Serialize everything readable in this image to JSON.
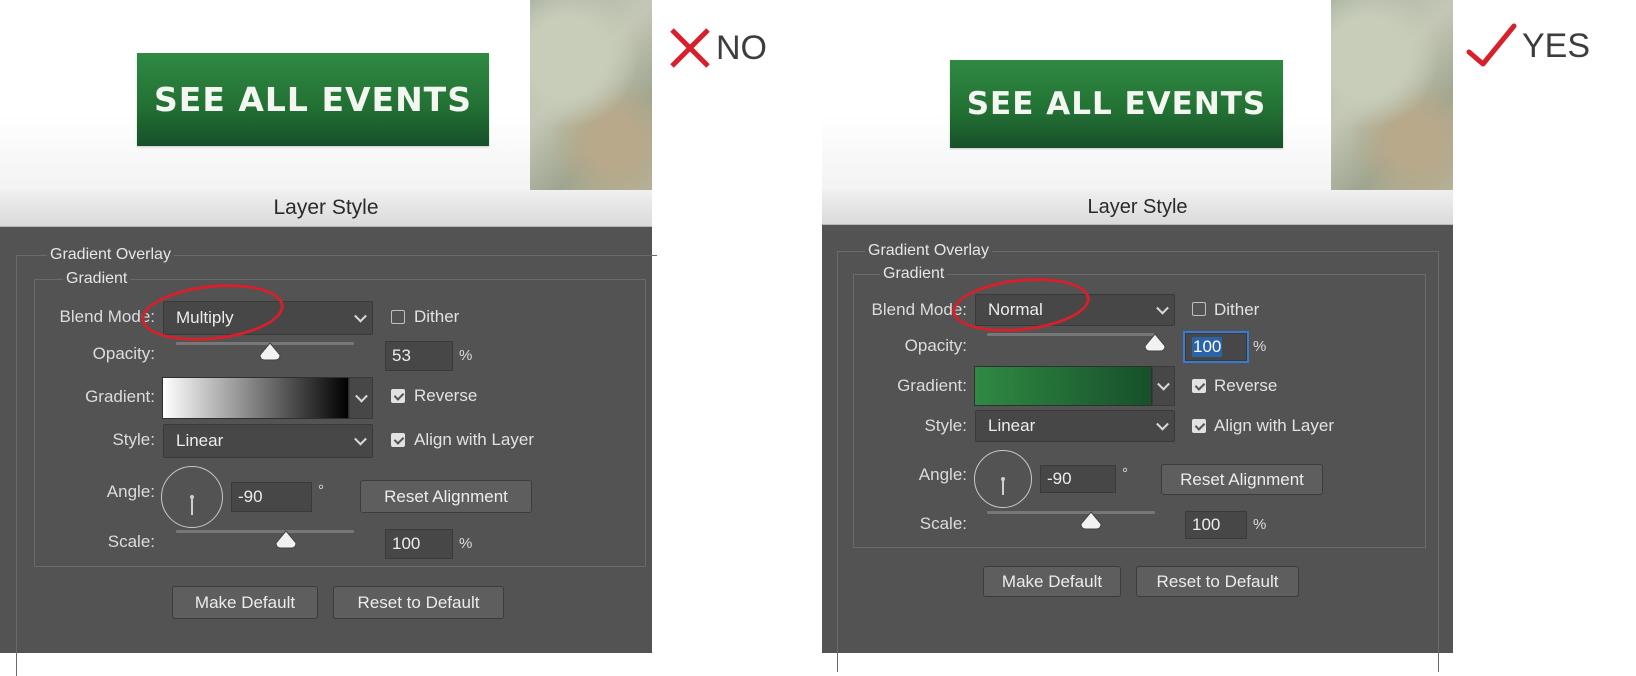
{
  "left": {
    "event_button": "SEE ALL EVENTS",
    "dialog_title": "Layer Style",
    "section_title": "Gradient Overlay",
    "group_title": "Gradient",
    "blend_mode_label": "Blend Mode:",
    "blend_mode_value": "Multiply",
    "dither_label": "Dither",
    "dither_checked": false,
    "opacity_label": "Opacity:",
    "opacity_value": "53",
    "opacity_unit": "%",
    "opacity_fraction": 0.53,
    "gradient_label": "Gradient:",
    "gradient_colors": [
      "#ffffff",
      "#000000"
    ],
    "reverse_label": "Reverse",
    "reverse_checked": true,
    "style_label": "Style:",
    "style_value": "Linear",
    "align_label": "Align with Layer",
    "align_checked": true,
    "angle_label": "Angle:",
    "angle_value": "-90",
    "angle_unit": "°",
    "reset_alignment": "Reset Alignment",
    "scale_label": "Scale:",
    "scale_value": "100",
    "scale_unit": "%",
    "scale_fraction": 0.62,
    "make_default": "Make Default",
    "reset_default": "Reset to Default"
  },
  "right": {
    "event_button": "SEE ALL EVENTS",
    "dialog_title": "Layer Style",
    "section_title": "Gradient Overlay",
    "group_title": "Gradient",
    "blend_mode_label": "Blend Mode:",
    "blend_mode_value": "Normal",
    "dither_label": "Dither",
    "dither_checked": false,
    "opacity_label": "Opacity:",
    "opacity_value": "100",
    "opacity_unit": "%",
    "opacity_fraction": 1.0,
    "gradient_label": "Gradient:",
    "gradient_colors": [
      "#2f8a43",
      "#17502a"
    ],
    "reverse_label": "Reverse",
    "reverse_checked": true,
    "style_label": "Style:",
    "style_value": "Linear",
    "align_label": "Align with Layer",
    "align_checked": true,
    "angle_label": "Angle:",
    "angle_value": "-90",
    "angle_unit": "°",
    "reset_alignment": "Reset Alignment",
    "scale_label": "Scale:",
    "scale_value": "100",
    "scale_unit": "%",
    "scale_fraction": 0.62,
    "make_default": "Make Default",
    "reset_default": "Reset to Default"
  },
  "verdicts": {
    "no_label": "NO",
    "yes_label": "YES",
    "no_color": "#d81f2c",
    "yes_color": "#d81f2c"
  },
  "colors": {
    "highlight_circle": "#d81f2c",
    "button_green": "#237234",
    "dialog_bg": "#535353"
  }
}
